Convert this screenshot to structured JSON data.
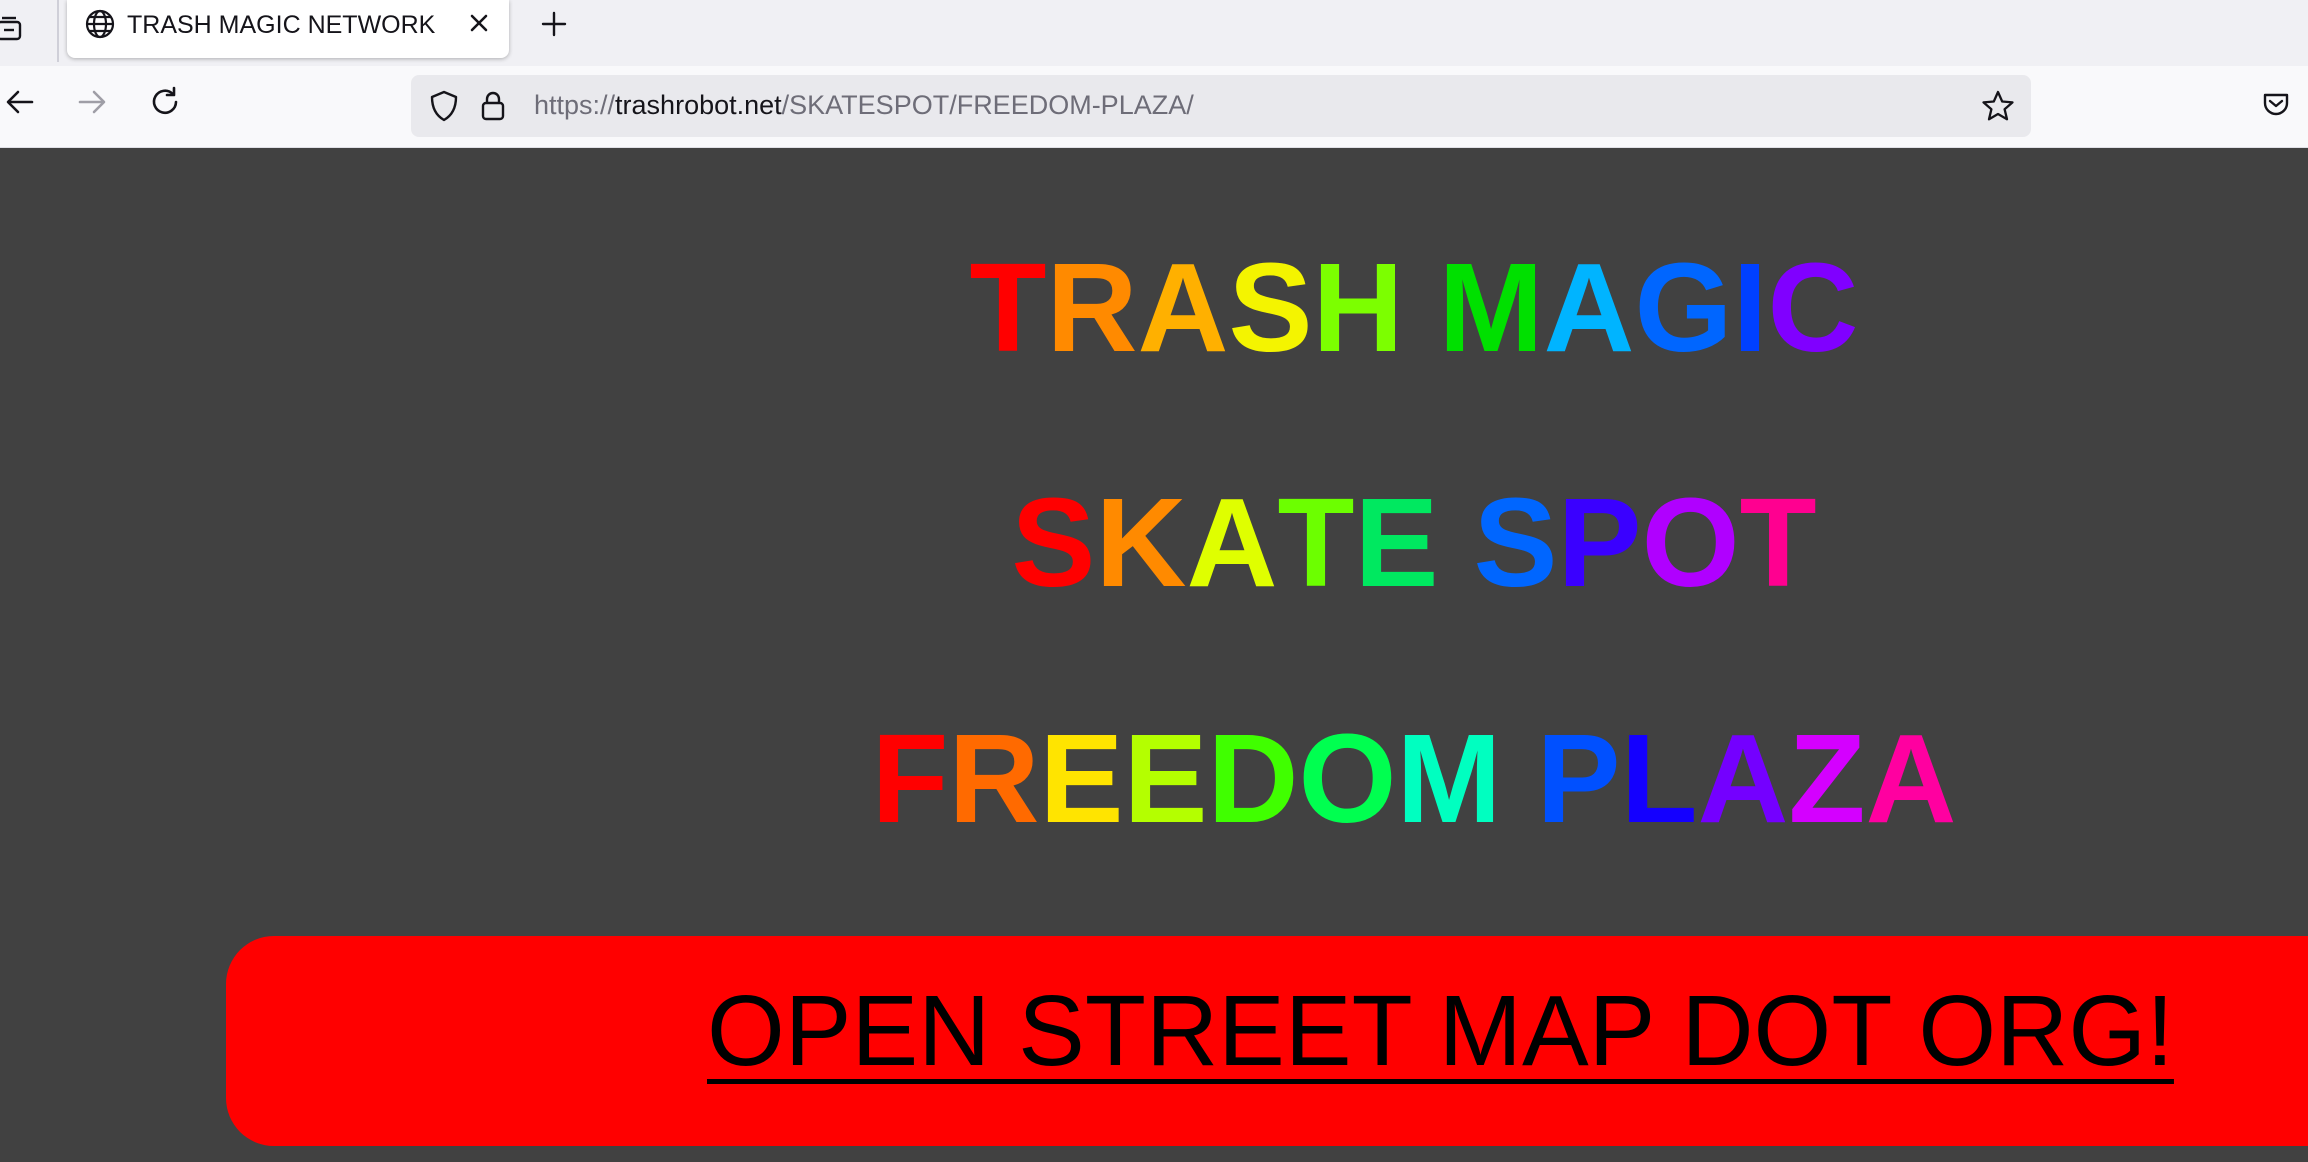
{
  "browser": {
    "tab": {
      "title": "TRASH MAGIC NETWORK",
      "favicon": "globe-icon"
    },
    "url": {
      "scheme": "https://",
      "host": "trashrobot.net",
      "path": "/SKATESPOT/FREEDOM-PLAZA/"
    },
    "icons": {
      "tab_list": "tab-list-icon",
      "close_tab": "close-icon",
      "new_tab": "plus-icon",
      "back": "back-arrow-icon",
      "forward": "forward-arrow-icon",
      "reload": "reload-icon",
      "shield": "shield-icon",
      "lock": "lock-icon",
      "bookmark": "star-icon",
      "pocket": "pocket-icon"
    }
  },
  "page": {
    "headings": [
      {
        "text": "TRASH MAGIC",
        "colors": [
          "#ff0000",
          "#ff8a00",
          "#ffb000",
          "#f4f400",
          "#7cff00",
          "#00e000",
          "#00b4ff",
          "#0066ff",
          "#0040ff",
          "#8000ff",
          "#cc00ff",
          "#ff0090"
        ]
      },
      {
        "text": "SKATE SPOT",
        "colors": [
          "#ff0000",
          "#ff8a00",
          "#dfff00",
          "#6cff00",
          "#00e860",
          "#0066ff",
          "#3a00ff",
          "#b000ff",
          "#ff0090"
        ]
      },
      {
        "text": "FREEDOM PLAZA",
        "colors": [
          "#ff0000",
          "#ff6a00",
          "#ffe400",
          "#b4ff00",
          "#40ff00",
          "#00ff50",
          "#00ffc0",
          "#0050ff",
          "#1400ff",
          "#7400ff",
          "#d400ff",
          "#ff00a0"
        ]
      }
    ],
    "banner": {
      "link_text": "OPEN STREET MAP DOT ORG!",
      "background": "#ff0000"
    },
    "background": "#414141"
  }
}
